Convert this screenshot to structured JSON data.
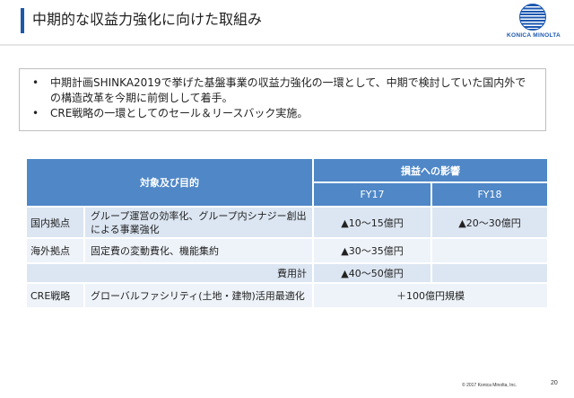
{
  "header": {
    "title": "中期的な収益力強化に向けた取組み",
    "logo_text": "KONICA MINOLTA"
  },
  "bullets": [
    "中期計画SHINKA2019で挙げた基盤事業の収益力強化の一環として、中期で検討していた国内外での構造改革を今期に前倒しして着手。",
    "CRE戦略の一環としてのセール＆リースバック実施。"
  ],
  "table": {
    "header_target": "対象及び目的",
    "header_impact": "損益への影響",
    "col_fy17": "FY17",
    "col_fy18": "FY18",
    "rows": [
      {
        "label": "国内拠点",
        "desc": "グループ運営の効率化、グループ内シナジー創出による事業強化",
        "fy17": "▲10～15億円",
        "fy18": "▲20～30億円"
      },
      {
        "label": "海外拠点",
        "desc": "固定費の変動費化、機能集約",
        "fy17": "▲30～35億円",
        "fy18": ""
      }
    ],
    "total_label": "費用計",
    "total_fy17": "▲40～50億円",
    "cre_label": "CRE戦略",
    "cre_desc": "グローバルファシリティ(土地・建物)活用最適化",
    "cre_value": "＋100億円規模"
  },
  "footer": {
    "copyright": "© 2017 Konica Minolta, Inc.",
    "page": "20"
  }
}
